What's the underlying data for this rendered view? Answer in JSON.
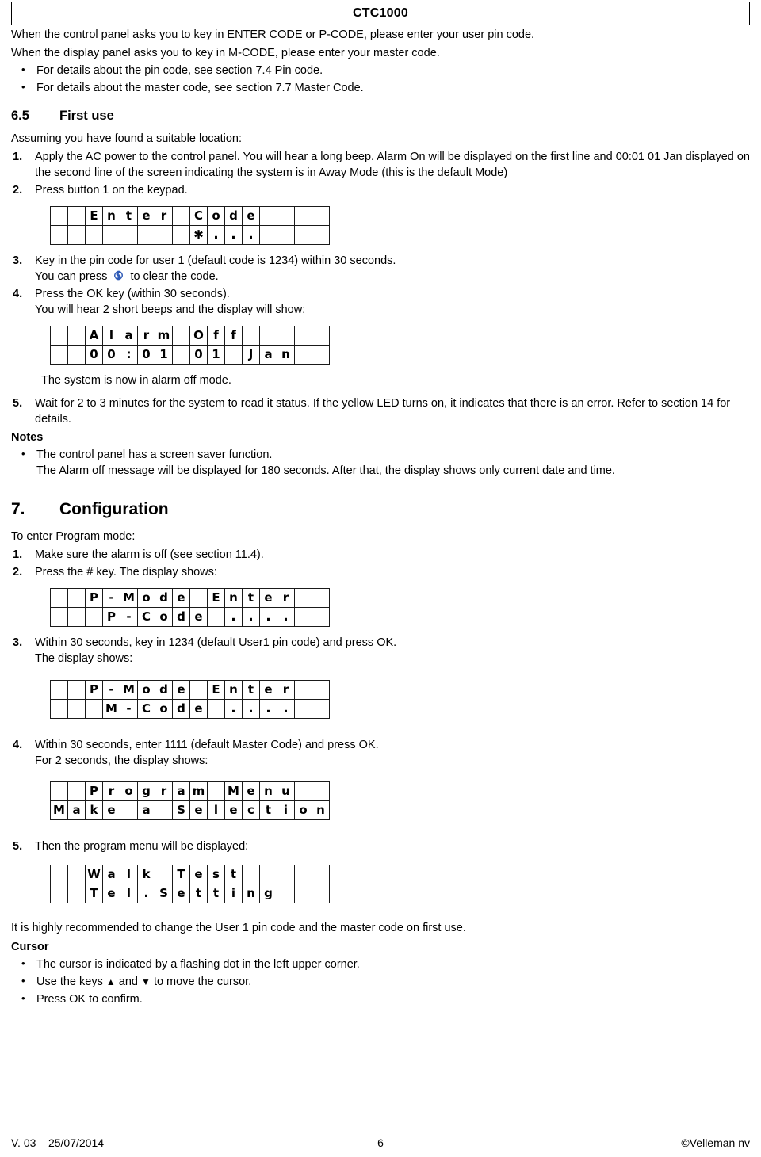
{
  "header": {
    "title": "CTC1000"
  },
  "intro": {
    "line1": "When the control panel asks you to key in ENTER CODE or P-CODE, please enter your user pin code.",
    "line2": "When the display panel asks you to key in M-CODE, please enter your master code.",
    "bullets": [
      "For details about the pin code, see section 7.4 Pin code.",
      "For details about the master code, see section 7.7 Master Code."
    ]
  },
  "section_6_5": {
    "number": "6.5",
    "title": "First use",
    "lead": "Assuming you have found a suitable location:",
    "steps": [
      {
        "num": "1.",
        "text": "Apply the AC power to the control panel. You will hear a long beep. Alarm On will be displayed on the first line and 00:01 01 Jan displayed on the second line of the screen indicating the system is in Away Mode (this is the default Mode)"
      },
      {
        "num": "2.",
        "text": "Press button 1 on the keypad."
      },
      {
        "num": "3.",
        "text_before": "Key in the pin code for user 1 (default code is 1234) within 30 seconds.",
        "text_line2_a": "You can press",
        "icon": "refresh-icon",
        "text_line2_b": "to clear the code."
      },
      {
        "num": "4.",
        "text_line1": "Press the OK key (within 30 seconds).",
        "text_line2": "You will hear 2 short beeps and the display will show:"
      },
      {
        "num": "5.",
        "text": "Wait for 2 to 3 minutes for the system to read it status. If the yellow LED turns on, it indicates that there is an error. Refer to section 14 for details."
      }
    ],
    "alarm_off_caption": "The system is now in alarm off mode.",
    "notes_heading": "Notes",
    "notes": [
      "The control panel has a screen saver function.",
      "The Alarm off message will be displayed for 180 seconds. After that, the display shows only current date and time."
    ]
  },
  "section_7": {
    "number": "7.",
    "title": "Configuration",
    "lead": "To enter Program mode:",
    "steps": [
      {
        "num": "1.",
        "text": "Make sure the alarm is off (see section 11.4)."
      },
      {
        "num": "2.",
        "text": "Press the # key. The display shows:"
      },
      {
        "num": "3.",
        "text_line1": "Within 30 seconds, key in 1234 (default User1 pin code) and press OK.",
        "text_line2": "The display shows:"
      },
      {
        "num": "4.",
        "text_line1": "Within 30 seconds, enter 1111 (default Master Code) and press OK.",
        "text_line2": "For 2 seconds, the display shows:"
      },
      {
        "num": "5.",
        "text": "Then the program menu will be displayed:"
      }
    ],
    "recommend": "It is highly recommended to change the User 1 pin code and the master code on first use.",
    "cursor_heading": "Cursor",
    "cursor_bullets": [
      {
        "text": "The cursor is indicated by a flashing dot in the left upper corner."
      },
      {
        "text_a": "Use the keys",
        "up": "▲",
        "text_b": "and",
        "down": "▼",
        "text_c": "to move the cursor."
      },
      {
        "text": "Press OK to confirm."
      }
    ]
  },
  "lcd_displays": {
    "enter_code": {
      "cols": 16,
      "row1": [
        " ",
        " ",
        "E",
        "n",
        "t",
        "e",
        "r",
        " ",
        "C",
        "o",
        "d",
        "e",
        " ",
        " ",
        " ",
        " "
      ],
      "row2": [
        " ",
        " ",
        " ",
        " ",
        " ",
        " ",
        " ",
        " ",
        "✱",
        ".",
        ".",
        ".",
        " ",
        " ",
        " ",
        " "
      ]
    },
    "alarm_off": {
      "cols": 16,
      "row1": [
        " ",
        " ",
        "A",
        "l",
        "a",
        "r",
        "m",
        " ",
        "O",
        "f",
        "f",
        " ",
        " ",
        " ",
        " ",
        " "
      ],
      "row2": [
        " ",
        " ",
        "0",
        "0",
        ":",
        "0",
        "1",
        " ",
        "0",
        "1",
        " ",
        "J",
        "a",
        "n",
        " ",
        " "
      ]
    },
    "p_mode_p_code": {
      "cols": 16,
      "row1": [
        " ",
        " ",
        "P",
        "-",
        "M",
        "o",
        "d",
        "e",
        " ",
        "E",
        "n",
        "t",
        "e",
        "r",
        " ",
        " "
      ],
      "row2": [
        " ",
        " ",
        " ",
        "P",
        "-",
        "C",
        "o",
        "d",
        "e",
        " ",
        ".",
        ".",
        ".",
        ".",
        " ",
        " "
      ]
    },
    "p_mode_m_code": {
      "cols": 16,
      "row1": [
        " ",
        " ",
        "P",
        "-",
        "M",
        "o",
        "d",
        "e",
        " ",
        "E",
        "n",
        "t",
        "e",
        "r",
        " ",
        " "
      ],
      "row2": [
        " ",
        " ",
        " ",
        "M",
        "-",
        "C",
        "o",
        "d",
        "e",
        " ",
        ".",
        ".",
        ".",
        ".",
        " ",
        " "
      ]
    },
    "program_menu": {
      "cols": 16,
      "row1": [
        " ",
        " ",
        "P",
        "r",
        "o",
        "g",
        "r",
        "a",
        "m",
        " ",
        "M",
        "e",
        "n",
        "u",
        " ",
        " "
      ],
      "row2": [
        "M",
        "a",
        "k",
        "e",
        " ",
        "a",
        " ",
        "S",
        "e",
        "l",
        "e",
        "c",
        "t",
        "i",
        "o",
        "n"
      ]
    },
    "walk_test": {
      "cols": 16,
      "row1": [
        " ",
        " ",
        "W",
        "a",
        "l",
        "k",
        " ",
        "T",
        "e",
        "s",
        "t",
        " ",
        " ",
        " ",
        " ",
        " "
      ],
      "row2": [
        " ",
        " ",
        "T",
        "e",
        "l",
        ".",
        "S",
        "e",
        "t",
        "t",
        "i",
        "n",
        "g",
        " ",
        " ",
        " "
      ]
    }
  },
  "footer": {
    "version": "V. 03 – 25/07/2014",
    "page": "6",
    "copyright": "©Velleman nv"
  },
  "colors": {
    "icon_blue": "#2f5bb7",
    "text": "#000000",
    "rule": "#000000"
  }
}
